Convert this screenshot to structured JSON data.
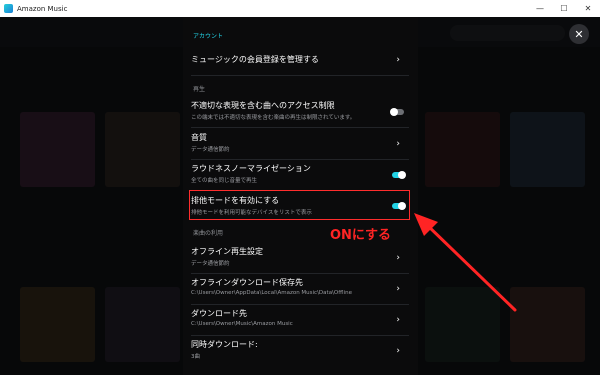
{
  "window": {
    "title": "Amazon Music",
    "controls": [
      "—",
      "☐",
      "✕"
    ]
  },
  "sections": {
    "account": "アカウント",
    "playback": "再生",
    "music_usage": "楽曲の利用"
  },
  "rows": {
    "membership": {
      "label": "ミュージックの会員登録を管理する"
    },
    "explicit": {
      "label": "不適切な表現を含む曲へのアクセス制限",
      "sub": "この端末では不適切な表現を含む楽曲の再生は制限されています。",
      "toggle": "off"
    },
    "quality": {
      "label": "音質",
      "sub": "データ通信節約"
    },
    "loudness": {
      "label": "ラウドネスノーマライゼーション",
      "sub": "全ての曲を同じ音量で再生",
      "toggle": "on"
    },
    "exclusive": {
      "label": "排他モードを有効にする",
      "sub": "排他モードを利用可能なデバイスをリストで表示",
      "toggle": "on"
    },
    "offline_quality": {
      "label": "オフライン再生設定",
      "sub": "データ通信節約"
    },
    "offline_location": {
      "label": "オフラインダウンロード保存先",
      "sub": "C:\\Users\\Owner\\AppData\\Local\\Amazon Music\\Data\\Offline"
    },
    "download_location": {
      "label": "ダウンロード先",
      "sub": "C:\\Users\\Owner\\Music\\Amazon Music"
    },
    "simultaneous": {
      "label": "同時ダウンロード:",
      "sub": "3曲"
    }
  },
  "annotation": {
    "text": "ONにする",
    "color": "#ff2424"
  },
  "colors": {
    "accent": "#22d3e6",
    "highlight": "#ff2d2d"
  },
  "icons": {
    "close": "close-icon",
    "chevron": "chevron-right-icon"
  }
}
